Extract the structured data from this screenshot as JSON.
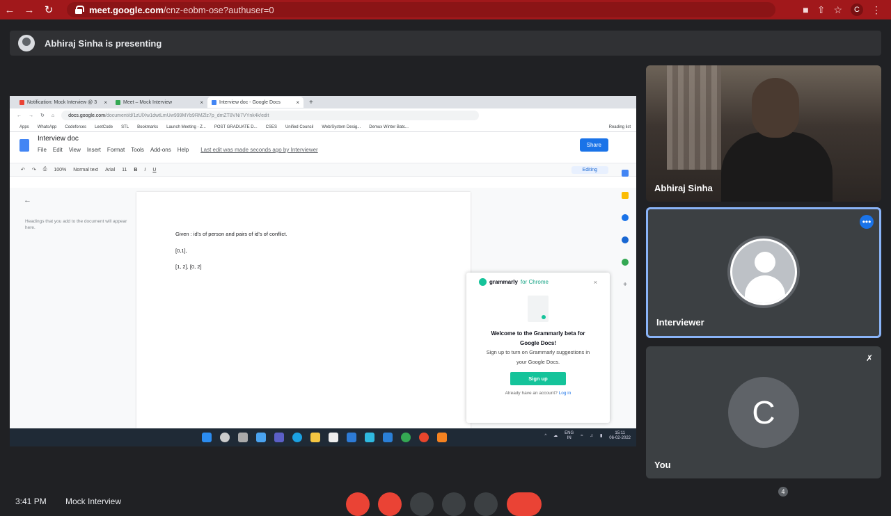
{
  "browser": {
    "url_host": "meet.google.com",
    "url_path": "/cnz-eobm-ose?authuser=0",
    "profile_initial": "C",
    "colors": {
      "chrome": "#a1181b",
      "url_bar": "#8b1416"
    }
  },
  "banner": {
    "text": "Abhiraj Sinha is presenting"
  },
  "shared_screen": {
    "tabs": [
      {
        "label": "Notification: Mock Interview @ 3"
      },
      {
        "label": "Meet – Mock Interview"
      },
      {
        "label": "Interview doc - Google Docs"
      }
    ],
    "address": {
      "host": "docs.google.com",
      "rest": "/document/d/1zUlXw1dwtLmUw999MYb9RMZlz7p_dmZT8VNi7VYnk4k/edit"
    },
    "bookmarks": [
      "Apps",
      "WhatsApp",
      "Codeforces",
      "LeetCode",
      "STL",
      "Bookmarks",
      "Launch Meeting - Z...",
      "POST GRADUATE D...",
      "CSES",
      "Unified Council",
      "Web/System Desig...",
      "Demux Winter Batc...",
      "Reading list"
    ],
    "doc": {
      "title": "Interview doc",
      "menu": [
        "File",
        "Edit",
        "View",
        "Insert",
        "Format",
        "Tools",
        "Add-ons",
        "Help"
      ],
      "last_edit": "Last edit was made seconds ago by Interviewer",
      "share_label": "Share",
      "toolbar": {
        "zoom": "100%",
        "style": "Normal text",
        "font": "Arial",
        "size": "11",
        "mode": "Editing"
      },
      "outline_hint": "Headings that you add to the document will appear here.",
      "lines": [
        "Given : id's of person and pairs of id's of conflict.",
        "[0,1],",
        "[1, 2], [0, 2]"
      ]
    },
    "grammarly": {
      "brand": "grammarly",
      "brand_suffix": "for Chrome",
      "title": "Welcome to the Grammarly beta for Google Docs!",
      "body": "Sign up to turn on Grammarly suggestions in your Google Docs.",
      "button": "Sign up",
      "login_prompt": "Already have an account?",
      "login_link": "Log in"
    },
    "taskbar": {
      "lang": "ENG",
      "region": "IN",
      "time": "15:11",
      "date": "06-02-2022"
    }
  },
  "participants": [
    {
      "name": "Abhiraj Sinha"
    },
    {
      "name": "Interviewer"
    },
    {
      "name": "You",
      "initial": "C"
    }
  ],
  "bottom_bar": {
    "time_text": "3:41 PM",
    "meeting_name": "Mock Interview",
    "participant_count": "4"
  }
}
